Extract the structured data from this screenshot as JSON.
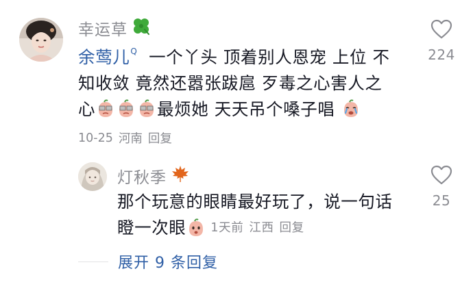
{
  "colors": {
    "link": "#2f5fa6",
    "secondary_text": "#8a8b91",
    "primary_text": "#161823"
  },
  "comments": [
    {
      "username": "幸运草",
      "name_badge": "four-leaf-clover-icon",
      "mention": "余莺儿",
      "mention_mark": "Q",
      "text_line1": "一个丫头  顶着别人恩宠 上位 不",
      "text_line2": "知收敛 竟然还嚣张跋扈 歹毒之心害人之",
      "text_line3_prefix": "心",
      "text_line3_suffix": "最烦她  天天吊个嗓子唱",
      "stickers": [
        "glasses-peach-sticker",
        "glasses-peach-sticker",
        "glasses-peach-sticker",
        "crying-peach-sticker"
      ],
      "date": "10-25",
      "location": "河南",
      "reply_label": "回复",
      "like_count": "224"
    },
    {
      "username": "灯秋季",
      "name_badge": "maple-leaf-icon",
      "text_line1": "那个玩意的眼睛最好玩了，说一句话",
      "text_line2": "瞪一次眼",
      "stickers": [
        "peach-sticker"
      ],
      "date": "1天前",
      "location": "江西",
      "reply_label": "回复",
      "like_count": "25"
    }
  ],
  "expand_replies": {
    "label": "展开 9 条回复"
  }
}
